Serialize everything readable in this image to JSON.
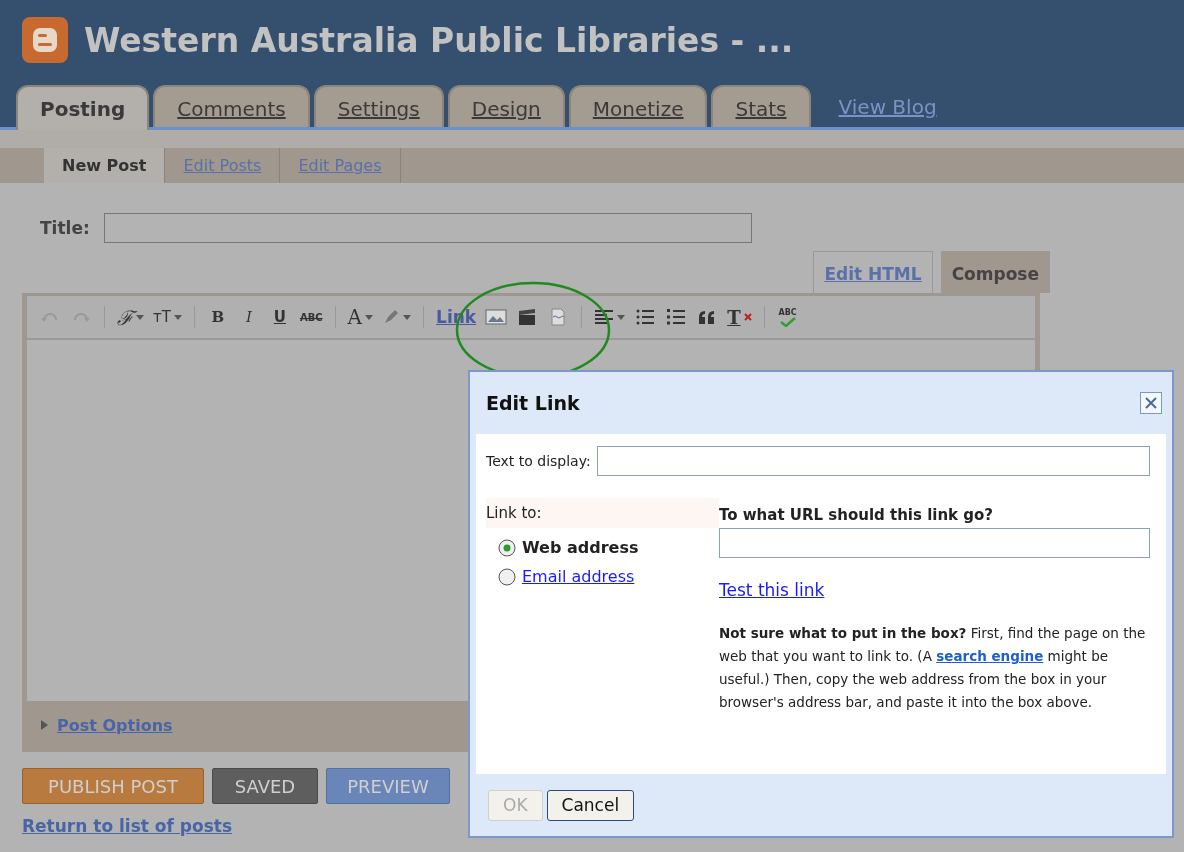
{
  "blog": {
    "title": "Western Australia Public Libraries - ..."
  },
  "tabs": [
    {
      "label": "Posting",
      "selected": true
    },
    {
      "label": "Comments",
      "selected": false
    },
    {
      "label": "Settings",
      "selected": false
    },
    {
      "label": "Design",
      "selected": false
    },
    {
      "label": "Monetize",
      "selected": false
    },
    {
      "label": "Stats",
      "selected": false
    }
  ],
  "view_blog": "View Blog",
  "subtabs": [
    {
      "label": "New Post",
      "selected": true
    },
    {
      "label": "Edit Posts",
      "selected": false
    },
    {
      "label": "Edit Pages",
      "selected": false
    }
  ],
  "title_field": {
    "label": "Title:"
  },
  "editor_modes": [
    {
      "label": "Edit HTML",
      "selected": false
    },
    {
      "label": "Compose",
      "selected": true
    }
  ],
  "toolbar": [
    {
      "kind": "undo"
    },
    {
      "kind": "redo"
    },
    {
      "kind": "sep"
    },
    {
      "kind": "font",
      "label": "ℱ"
    },
    {
      "kind": "size",
      "label": "тT"
    },
    {
      "kind": "sep"
    },
    {
      "kind": "bold",
      "label": "B"
    },
    {
      "kind": "italic",
      "label": "I"
    },
    {
      "kind": "underline",
      "label": "U"
    },
    {
      "kind": "strike",
      "label": "ABC"
    },
    {
      "kind": "sep"
    },
    {
      "kind": "color",
      "label": "A"
    },
    {
      "kind": "highlight"
    },
    {
      "kind": "sep"
    },
    {
      "kind": "link",
      "label": "Link"
    },
    {
      "kind": "image"
    },
    {
      "kind": "video"
    },
    {
      "kind": "jump"
    },
    {
      "kind": "sep"
    },
    {
      "kind": "align"
    },
    {
      "kind": "numbered"
    },
    {
      "kind": "bullets"
    },
    {
      "kind": "quote"
    },
    {
      "kind": "clear",
      "label": "T"
    },
    {
      "kind": "sep"
    },
    {
      "kind": "spell",
      "label": "ABC"
    }
  ],
  "post_options": {
    "label": "Post Options",
    "expanded": false
  },
  "actions": [
    {
      "label": "PUBLISH POST",
      "kind": "publish"
    },
    {
      "label": "SAVED",
      "kind": "saved"
    },
    {
      "label": "PREVIEW",
      "kind": "preview"
    }
  ],
  "return_link": "Return to list of posts",
  "dialog": {
    "title": "Edit Link",
    "text_label": "Text to display:",
    "link_to_label": "Link to:",
    "options": [
      {
        "label": "Web address",
        "selected": true
      },
      {
        "label": "Email address",
        "selected": false
      }
    ],
    "url_label": "To what URL should this link go?",
    "test_link": "Test this link",
    "help_before": "**Not sure what to put in the box?** First, find the page on the web that you want to link to. (A",
    "help_link": "search engine",
    "help_after": "might be useful.) Then, copy the web address from the box in your browser's address bar, and paste it into the box above.",
    "buttons": [
      {
        "label": "OK",
        "disabled": true
      },
      {
        "label": "Cancel",
        "disabled": false
      }
    ]
  }
}
